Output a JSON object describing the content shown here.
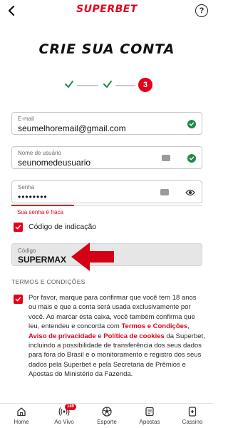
{
  "header": {
    "brand": "SUPERBET",
    "help_label": "?"
  },
  "page": {
    "title": "CRIE SUA CONTA"
  },
  "stepper": {
    "current_step": "3"
  },
  "form": {
    "email": {
      "label": "E-mail",
      "value": "seumelhoremail@gmail.com"
    },
    "username": {
      "label": "Nome de usuário",
      "value": "seunomedeusuario"
    },
    "password": {
      "label": "Senha",
      "value": "••••••••",
      "strength_hint": "Sua senha é fraca",
      "strength_fraction": 0.33
    },
    "referral_toggle_label": "Código de indicação",
    "referral": {
      "label": "Código",
      "value": "SUPERMAX"
    }
  },
  "terms": {
    "section_title": "TERMOS E CONDIÇÕES",
    "text_1": "Por favor, marque para confirmar que você tem 18 anos ou mais e que a conta será usada exclusivamente por você. Ao marcar esta caixa, você também confirma que leu, entendeu e concorda com ",
    "link_terms": "Termos e Condições",
    "sep_1": ", ",
    "link_privacy": "Aviso de privacidade",
    "sep_2": " e ",
    "link_cookies": "Política de cookies",
    "text_2": " da Superbet, incluindo a possibilidade de transferência dos seus dados para fora do Brasil e o monitoramento e registro dos seus dados pela Superbet e pela Secretaria de Prêmios e Apostas do Ministério da Fazenda."
  },
  "bottom_nav": {
    "home": "Home",
    "live": "Ao Vivo",
    "live_badge": "189",
    "sport": "Esporte",
    "bets": "Apostas",
    "casino": "Cassino"
  },
  "colors": {
    "brand_red": "#e5001b",
    "success_green": "#1f8a4c"
  }
}
